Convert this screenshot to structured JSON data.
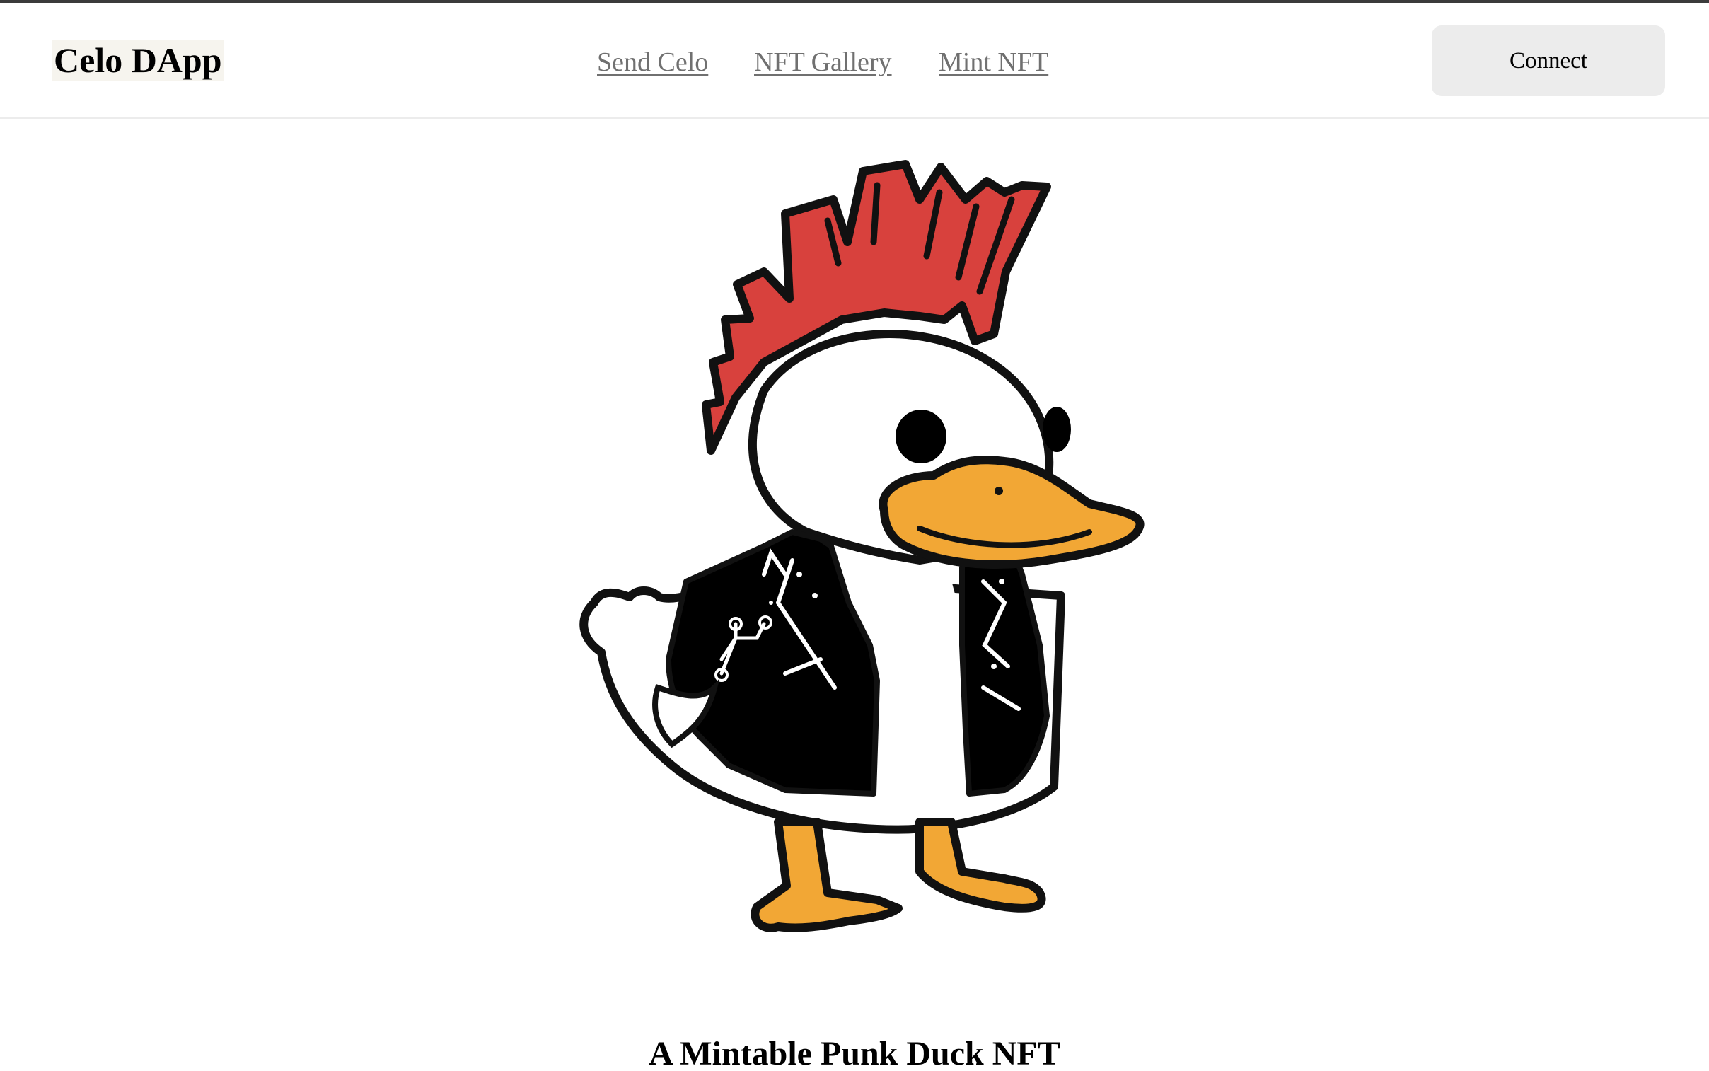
{
  "app": {
    "title": "Celo DApp"
  },
  "nav": {
    "items": [
      {
        "label": "Send Celo"
      },
      {
        "label": "NFT Gallery"
      },
      {
        "label": "Mint NFT"
      }
    ]
  },
  "header": {
    "connect_label": "Connect"
  },
  "main": {
    "image_icon": "punk-duck-illustration",
    "title": "A Mintable Punk Duck NFT"
  },
  "colors": {
    "mohawk": "#d8413d",
    "beak": "#f2a735",
    "jacket": "#000000",
    "outline": "#111111",
    "button_bg": "#ececec",
    "link": "#707070"
  }
}
